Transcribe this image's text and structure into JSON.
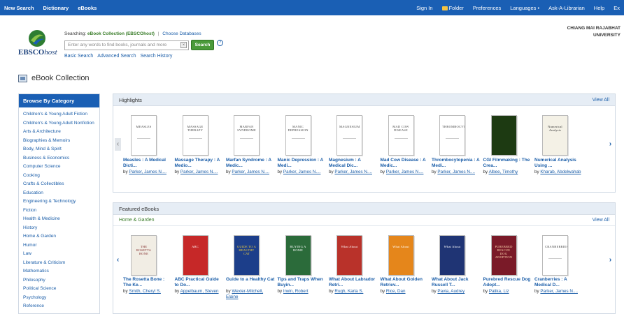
{
  "topbar": {
    "left": [
      "New Search",
      "Dictionary",
      "eBooks"
    ],
    "sign_in": "Sign In",
    "folder": "Folder",
    "preferences": "Preferences",
    "languages": "Languages •",
    "ask": "Ask-A-Librarian",
    "help": "Help",
    "exit": "Ex"
  },
  "header": {
    "logo_main": "EBSCO",
    "logo_italic": "host",
    "searching_label": "Searching:",
    "searching_db": "eBook Collection (EBSCOhost)",
    "choose_db": "Choose Databases",
    "search_placeholder": "Enter any words to find books, journals and more",
    "search_button": "Search",
    "help_icon": "?",
    "links": [
      "Basic Search",
      "Advanced Search",
      "Search History"
    ],
    "institution_line1": "CHIANG MAI RAJABHAT",
    "institution_line2": "UNIVERSITY"
  },
  "page_title": "eBook Collection",
  "sidebar": {
    "title": "Browse By Category",
    "items": [
      "Children's & Young Adult Fiction",
      "Children's & Young Adult Nonfiction",
      "Arts & Architecture",
      "Biographies & Memoirs",
      "Body, Mind & Spirit",
      "Business & Economics",
      "Computer Science",
      "Cooking",
      "Crafts & Collectibles",
      "Education",
      "Engineering & Technology",
      "Fiction",
      "Health & Medicine",
      "History",
      "Home & Garden",
      "Humor",
      "Law",
      "Literature & Criticism",
      "Mathematics",
      "Philosophy",
      "Political Science",
      "Psychology",
      "Reference"
    ]
  },
  "highlights": {
    "title": "Highlights",
    "view_all": "View All",
    "books": [
      {
        "title": "Measles : A Medical Dicti...",
        "by": "by",
        "author": "Parker, James N....",
        "cover_text": "MEASLES",
        "style": "plain"
      },
      {
        "title": "Massage Therapy : A Medio...",
        "by": "by",
        "author": "Parker, James N....",
        "cover_text": "MASSAGE THERAPY",
        "style": "plain"
      },
      {
        "title": "Marfan Syndrome : A Medic...",
        "by": "by",
        "author": "Parker, James N....",
        "cover_text": "MARFAN SYNDROME",
        "style": "plain"
      },
      {
        "title": "Manic Depression : A Medi...",
        "by": "by",
        "author": "Parker, James N....",
        "cover_text": "MANIC DEPRESSION",
        "style": "plain"
      },
      {
        "title": "Magnesium : A Medical Dic...",
        "by": "by",
        "author": "Parker, James N....",
        "cover_text": "MAGNESIUM",
        "style": "plain"
      },
      {
        "title": "Mad Cow Disease : A Medic...",
        "by": "by",
        "author": "Parker, James N....",
        "cover_text": "MAD COW DISEASE",
        "style": "plain"
      },
      {
        "title": "Thrombocytopenia : A Medi...",
        "by": "by",
        "author": "Parker, James N....",
        "cover_text": "THROMBOCYTOPENIA",
        "style": "plain"
      },
      {
        "title": "CGI Filmmaking : The Crea...",
        "by": "by",
        "author": "Albee, Timothy",
        "cover_text": "",
        "style": "cgi"
      },
      {
        "title": "Numerical Analysis Using ...",
        "by": "by",
        "author": "Kharab, Abdelwahab",
        "cover_text": "Numerical Analysis",
        "style": "numerical"
      }
    ]
  },
  "featured": {
    "title": "Featured eBooks",
    "category": "Home & Garden",
    "view_all": "View All",
    "books": [
      {
        "title": "The Rosetta Bone : The Ke...",
        "by": "by",
        "author": "Smith, Cheryl S.",
        "cover_text": "THE ROSETTA BONE",
        "style": "rosetta"
      },
      {
        "title": "ABC Practical Guide to Do...",
        "by": "by",
        "author": "Appelbaum, Steven",
        "cover_text": "ABC",
        "style": "abc"
      },
      {
        "title": "Guide to a Healthy Cat",
        "by": "by",
        "author": "Wexler-Mitchell, Elaine",
        "cover_text": "GUIDE TO A HEALTHY CAT",
        "style": "cat"
      },
      {
        "title": "Tips and Traps When Buyin...",
        "by": "by",
        "author": "Irwin, Robert",
        "cover_text": "BUYING A HOME",
        "style": "tips"
      },
      {
        "title": "What About Labrador Retri...",
        "by": "by",
        "author": "Rugh, Karla S.",
        "cover_text": "What About",
        "style": "dog_red"
      },
      {
        "title": "What About Golden Retriev...",
        "by": "by",
        "author": "Rice, Dan",
        "cover_text": "What About",
        "style": "dog_orange"
      },
      {
        "title": "What About Jack Russell T...",
        "by": "by",
        "author": "Pavia, Audrey",
        "cover_text": "What About",
        "style": "dog_navy"
      },
      {
        "title": "Purebred Rescue Dog Adopt...",
        "by": "by",
        "author": "Palika, Liz",
        "cover_text": "PUREBRED RESCUE DOG ADOPTION",
        "style": "purebred"
      },
      {
        "title": "Cranberries : A Medical D...",
        "by": "by",
        "author": "Parker, James N....",
        "cover_text": "CRANBERRIES",
        "style": "plain"
      }
    ]
  },
  "colors": {
    "accent": "#1a5fb4",
    "link": "#1a5da8",
    "green": "#4a9a3a",
    "panel_header": "#e6edf5"
  }
}
